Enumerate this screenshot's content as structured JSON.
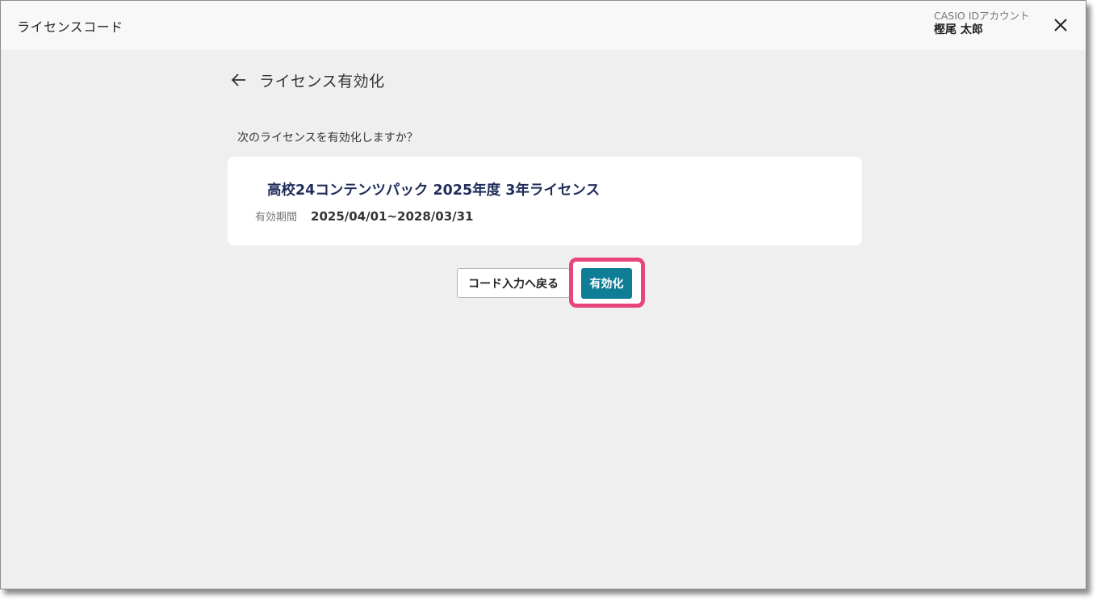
{
  "header": {
    "title": "ライセンスコード",
    "account_label": "CASIO IDアカウント",
    "account_user": "樫尾 太郎"
  },
  "page": {
    "title": "ライセンス有効化",
    "prompt": "次のライセンスを有効化しますか？"
  },
  "license": {
    "name": "高校24コンテンツパック 2025年度 3年ライセンス",
    "validity_label": "有効期間",
    "validity_value": "2025/04/01~2028/03/31"
  },
  "actions": {
    "back_label": "コード入力へ戻る",
    "activate_label": "有効化"
  },
  "icons": {
    "back": "arrow-left-icon",
    "close": "close-icon"
  },
  "colors": {
    "primary": "#0f7d96",
    "highlight": "#e8457f",
    "title_text": "#1f2d5a",
    "background": "#efefef"
  }
}
